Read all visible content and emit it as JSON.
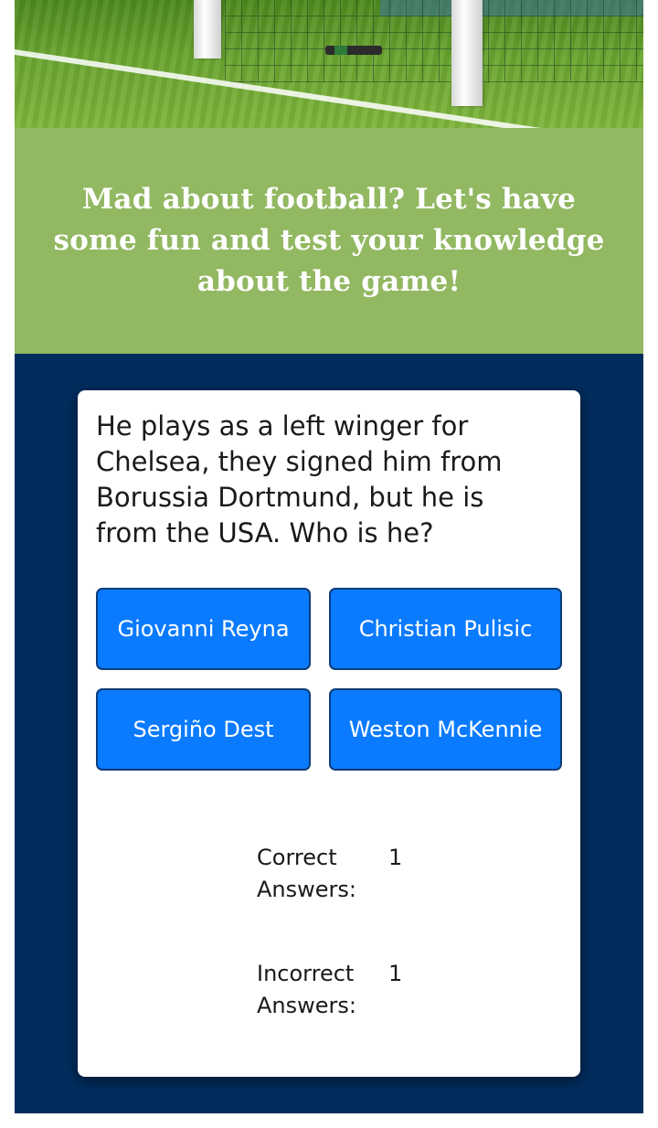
{
  "banner": {
    "text": "Mad about football? Let's have some fun and test your knowledge about the game!"
  },
  "quiz": {
    "question": "He plays as a left winger for Chelsea, they signed him from Borussia Dortmund, but he is from the USA. Who is he?",
    "answers": [
      {
        "label": "Giovanni Reyna"
      },
      {
        "label": "Christian Pulisic"
      },
      {
        "label": "Sergiño Dest"
      },
      {
        "label": "Weston McKennie"
      }
    ],
    "score": {
      "correct_label": "Correct Answers:",
      "correct_value": "1",
      "incorrect_label": "Incorrect Answers:",
      "incorrect_value": "1"
    }
  },
  "colors": {
    "banner_bg": "#92b862",
    "main_bg": "#002d5e",
    "button_bg": "#0a7bff",
    "button_border": "#0b3d78"
  },
  "hero_image": {
    "icon": "football-goal-net-image"
  }
}
